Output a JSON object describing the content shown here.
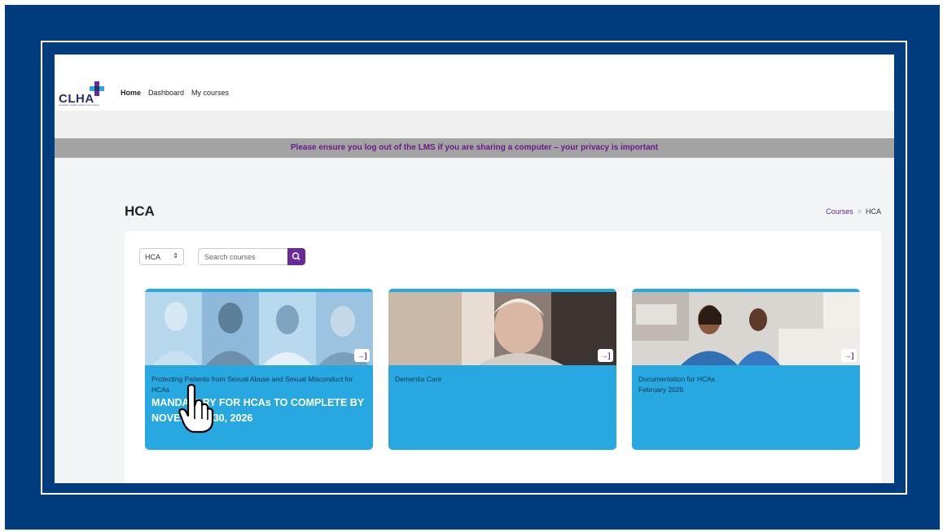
{
  "brand": {
    "logo_text": "CLHA",
    "logo_tagline": "Canadian Health Leaders Association"
  },
  "nav": {
    "items": [
      "Home",
      "Dashboard",
      "My courses"
    ]
  },
  "notice": "Please ensure you log out of the LMS if you are sharing a computer – your privacy is important",
  "page": {
    "title": "HCA"
  },
  "breadcrumb": {
    "parent": "Courses",
    "current": "HCA"
  },
  "filter": {
    "category_value": "HCA",
    "search_placeholder": "Search courses"
  },
  "courses": [
    {
      "title": "Protecting Patients from Sexual Abuse and Sexual Misconduct for HCAs",
      "subtitle": "MANDATORY FOR HCAs TO COMPLETE BY NOVEMBER 30, 2026"
    },
    {
      "title": "Dementia Care",
      "subtitle": ""
    },
    {
      "title": "Documentation for HCAs",
      "subtitle": "February 2026"
    }
  ],
  "colors": {
    "slide_bg": "#003c7e",
    "card_bg": "#28a8e0",
    "accent": "#6a2a9a",
    "notice_band": "#a3a3a3"
  },
  "icons": {
    "search": "search-icon",
    "enter": "enter-icon",
    "cursor": "hand-pointer-icon",
    "select": "sort-arrows-icon"
  }
}
